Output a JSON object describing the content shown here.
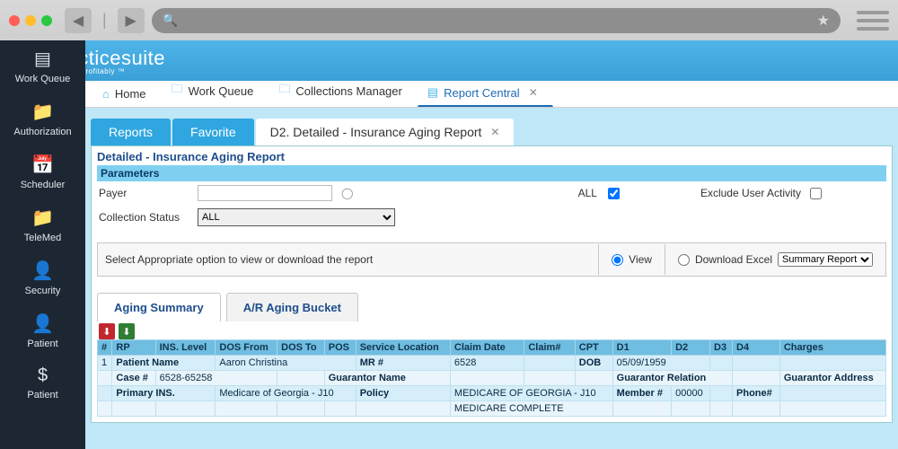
{
  "sidebar": {
    "items": [
      {
        "label": "Work Queue",
        "icon": "▤"
      },
      {
        "label": "Authorization",
        "icon": "📁"
      },
      {
        "label": "Scheduler",
        "icon": "📅"
      },
      {
        "label": "TeleMed",
        "icon": "📁"
      },
      {
        "label": "Security",
        "icon": "👤"
      },
      {
        "label": "Patient",
        "icon": "👤"
      },
      {
        "label": "Patient",
        "icon": "$"
      }
    ]
  },
  "brand": {
    "name": "practicesuite",
    "tagline": "Practice Profitably ™"
  },
  "filetabs": [
    {
      "icon": "⌂",
      "label": "Home"
    },
    {
      "icon": "🗀",
      "label": "Work Queue"
    },
    {
      "icon": "🗀",
      "label": "Collections Manager"
    },
    {
      "icon": "▤",
      "label": "Report Central",
      "active": true,
      "closable": true
    }
  ],
  "pills": [
    {
      "label": "Reports"
    },
    {
      "label": "Favorite"
    }
  ],
  "activeTab": {
    "label": "D2. Detailed - Insurance Aging Report"
  },
  "panel": {
    "title": "Detailed - Insurance Aging Report",
    "paramHeader": "Parameters",
    "payerLabel": "Payer",
    "collectionStatusLabel": "Collection Status",
    "collectionStatusValue": "ALL",
    "allLabel": "ALL",
    "excludeLabel": "Exclude User Activity"
  },
  "optrow": {
    "hint": "Select Appropriate option to view or download the report",
    "view": "View",
    "download": "Download Excel",
    "downloadSelect": "Summary Report"
  },
  "subtabs": [
    {
      "label": "Aging Summary",
      "active": true
    },
    {
      "label": "A/R Aging Bucket"
    }
  ],
  "tableHeaders": [
    "#",
    "RP",
    "INS. Level",
    "DOS From",
    "DOS To",
    "POS",
    "Service Location",
    "Claim Date",
    "Claim#",
    "CPT",
    "D1",
    "D2",
    "D3",
    "D4",
    "Charges"
  ],
  "row1": {
    "num": "1",
    "patientNameLbl": "Patient Name",
    "patientName": "Aaron Christina",
    "mrLbl": "MR #",
    "claimNum": "6528",
    "dobLbl": "DOB",
    "dob": "05/09/1959"
  },
  "row2": {
    "caseLbl": "Case #",
    "caseVal": "6528-65258",
    "guarNameLbl": "Guarantor Name",
    "guarRelLbl": "Guarantor Relation",
    "guarAddrLbl": "Guarantor Address"
  },
  "row3": {
    "primLbl": "Primary INS.",
    "primVal": "Medicare of Georgia - J10",
    "policyLbl": "Policy",
    "planVal": "MEDICARE OF GEORGIA - J10",
    "memberLbl": "Member #",
    "memberVal": "00000",
    "phoneLbl": "Phone#"
  },
  "row4": {
    "planVal2": "MEDICARE COMPLETE"
  }
}
